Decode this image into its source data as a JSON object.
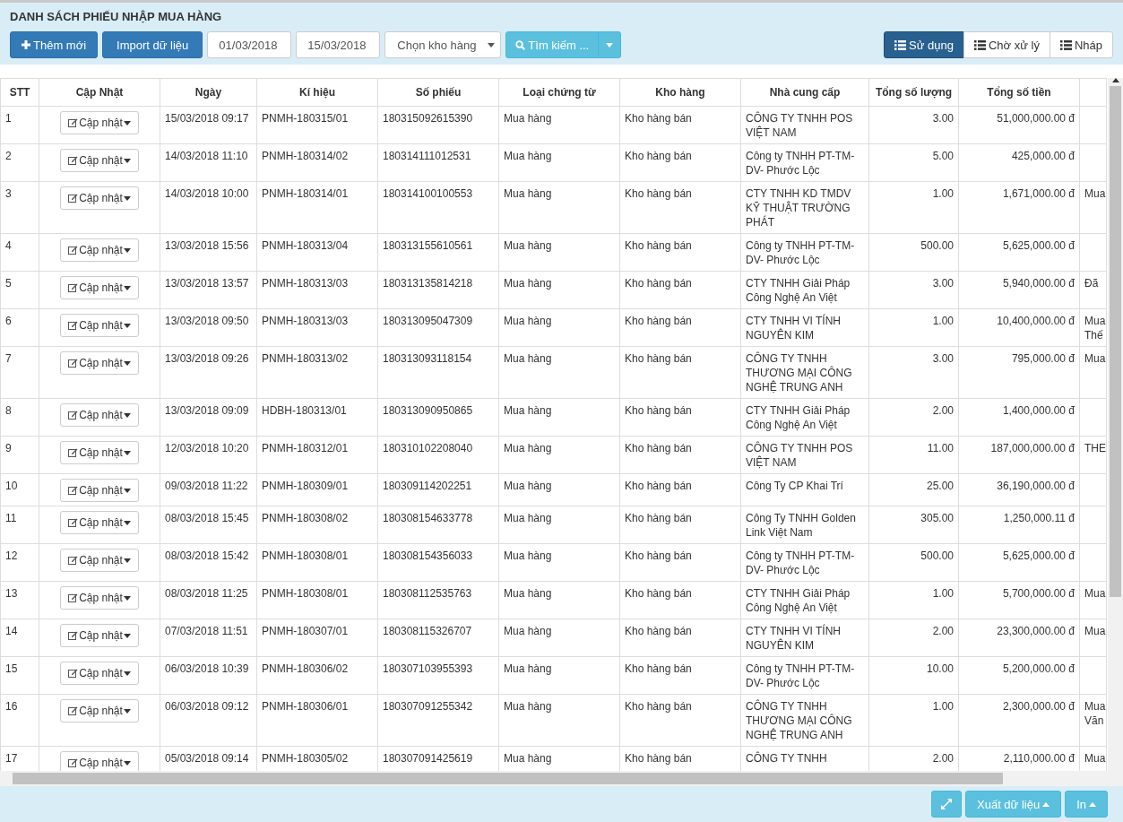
{
  "page_title": "DANH SÁCH PHIẾU NHẬP MUA HÀNG",
  "toolbar": {
    "add_button": "Thêm mới",
    "import_button": "Import dữ liệu",
    "date_from": "01/03/2018",
    "date_to": "15/03/2018",
    "warehouse_select": "Chọn kho hàng",
    "search_button": "Tìm kiếm ..."
  },
  "status_tabs": [
    {
      "label": "Sử dụng",
      "selected": true
    },
    {
      "label": "Chờ xử lý",
      "selected": false
    },
    {
      "label": "Nháp",
      "selected": false
    }
  ],
  "table": {
    "columns": [
      "STT",
      "Cập Nhật",
      "Ngày",
      "Kí hiệu",
      "Số phiếu",
      "Loại chứng từ",
      "Kho hàng",
      "Nhà cung cấp",
      "Tổng số lượng",
      "Tổng số tiền"
    ],
    "rows": [
      {
        "cells": [
          "1",
          "Cập nhật",
          "15/03/2018 09:17",
          "PNMH-180315/01",
          "180315092615390",
          "Mua hàng",
          "Kho hàng bán",
          "CÔNG TY TNHH POS VIỆT NAM",
          "3.00",
          "51,000,000.00 đ"
        ]
      },
      {
        "cells": [
          "2",
          "Cập nhật",
          "14/03/2018 11:10",
          "PNMH-180314/02",
          "180314111012531",
          "Mua hàng",
          "Kho hàng bán",
          "Công ty TNHH PT-TM-DV- Phước Lộc",
          "5.00",
          "425,000.00 đ"
        ]
      },
      {
        "cells": [
          "3",
          "Cập nhật",
          "14/03/2018 10:00",
          "PNMH-180314/01",
          "180314100100553",
          "Mua hàng",
          "Kho hàng bán",
          "CTY TNHH KD TMDV KỸ THUẬT TRƯỜNG PHÁT",
          "1.00",
          "1,671,000.00 đ"
        ],
        "column_11": "Mua"
      },
      {
        "cells": [
          "4",
          "Cập nhật",
          "13/03/2018 15:56",
          "PNMH-180313/04",
          "180313155610561",
          "Mua hàng",
          "Kho hàng bán",
          "Công ty TNHH PT-TM-DV- Phước Lộc",
          "500.00",
          "5,625,000.00 đ"
        ]
      },
      {
        "cells": [
          "5",
          "Cập nhật",
          "13/03/2018 13:57",
          "PNMH-180313/03",
          "180313135814218",
          "Mua hàng",
          "Kho hàng bán",
          "CTY TNHH Giải Pháp Công Nghệ An Việt",
          "3.00",
          "5,940,000.00 đ"
        ],
        "column_11": "Đã"
      },
      {
        "cells": [
          "6",
          "Cập nhật",
          "13/03/2018 09:50",
          "PNMH-180313/03",
          "180313095047309",
          "Mua hàng",
          "Kho hàng bán",
          "CTY TNHH VI TÍNH NGUYÊN KIM",
          "1.00",
          "10,400,000.00 đ"
        ],
        "column_11": "Mua Thế"
      },
      {
        "cells": [
          "7",
          "Cập nhật",
          "13/03/2018 09:26",
          "PNMH-180313/02",
          "180313093118154",
          "Mua hàng",
          "Kho hàng bán",
          "CÔNG TY TNHH THƯƠNG MẠI CÔNG NGHỆ TRUNG ANH",
          "3.00",
          "795,000.00 đ"
        ],
        "column_11": "Mua"
      },
      {
        "cells": [
          "8",
          "Cập nhật",
          "13/03/2018 09:09",
          "HDBH-180313/01",
          "180313090950865",
          "Mua hàng",
          "Kho hàng bán",
          "CTY TNHH Giải Pháp Công Nghệ An Việt",
          "2.00",
          "1,400,000.00 đ"
        ]
      },
      {
        "cells": [
          "9",
          "Cập nhật",
          "12/03/2018 10:20",
          "PNMH-180312/01",
          "180310102208040",
          "Mua hàng",
          "Kho hàng bán",
          "CÔNG TY TNHH POS VIỆT NAM",
          "11.00",
          "187,000,000.00 đ"
        ],
        "column_11": "THE"
      },
      {
        "cells": [
          "10",
          "Cập nhật",
          "09/03/2018 11:22",
          "PNMH-180309/01",
          "180309114202251",
          "Mua hàng",
          "Kho hàng bán",
          "Công Ty CP Khai Trí",
          "25.00",
          "36,190,000.00 đ"
        ]
      },
      {
        "cells": [
          "11",
          "Cập nhật",
          "08/03/2018 15:45",
          "PNMH-180308/02",
          "180308154633778",
          "Mua hàng",
          "Kho hàng bán",
          "Công Ty TNHH Golden Link Việt Nam",
          "305.00",
          "1,250,000.11 đ"
        ]
      },
      {
        "cells": [
          "12",
          "Cập nhật",
          "08/03/2018 15:42",
          "PNMH-180308/01",
          "180308154356033",
          "Mua hàng",
          "Kho hàng bán",
          "Công ty TNHH PT-TM-DV- Phước Lộc",
          "500.00",
          "5,625,000.00 đ"
        ]
      },
      {
        "cells": [
          "13",
          "Cập nhật",
          "08/03/2018 11:25",
          "PNMH-180308/01",
          "180308112535763",
          "Mua hàng",
          "Kho hàng bán",
          "CTY TNHH Giải Pháp Công Nghệ An Việt",
          "1.00",
          "5,700,000.00 đ"
        ],
        "column_11": "Mua"
      },
      {
        "cells": [
          "14",
          "Cập nhật",
          "07/03/2018 11:51",
          "PNMH-180307/01",
          "180308115326707",
          "Mua hàng",
          "Kho hàng bán",
          "CTY TNHH VI TÍNH NGUYÊN KIM",
          "2.00",
          "23,300,000.00 đ"
        ],
        "column_11": "Mua"
      },
      {
        "cells": [
          "15",
          "Cập nhật",
          "06/03/2018 10:39",
          "PNMH-180306/02",
          "180307103955393",
          "Mua hàng",
          "Kho hàng bán",
          "Công ty TNHH PT-TM-DV- Phước Lộc",
          "10.00",
          "5,200,000.00 đ"
        ]
      },
      {
        "cells": [
          "16",
          "Cập nhật",
          "06/03/2018 09:12",
          "PNMH-180306/01",
          "180307091255342",
          "Mua hàng",
          "Kho hàng bán",
          "CÔNG TY TNHH THƯƠNG MẠI CÔNG NGHỆ TRUNG ANH",
          "1.00",
          "2,300,000.00 đ"
        ],
        "column_11": "Mua Văn"
      },
      {
        "cells": [
          "17",
          "Cập nhật",
          "05/03/2018 09:14",
          "PNMH-180305/02",
          "180307091425619",
          "Mua hàng",
          "Kho hàng bán",
          "CÔNG TY TNHH",
          "2.00",
          "2,110,000.00 đ"
        ],
        "column_11": "Mua"
      }
    ]
  },
  "footer": {
    "export_button": "Xuất dữ liệu",
    "print_button": "In"
  }
}
